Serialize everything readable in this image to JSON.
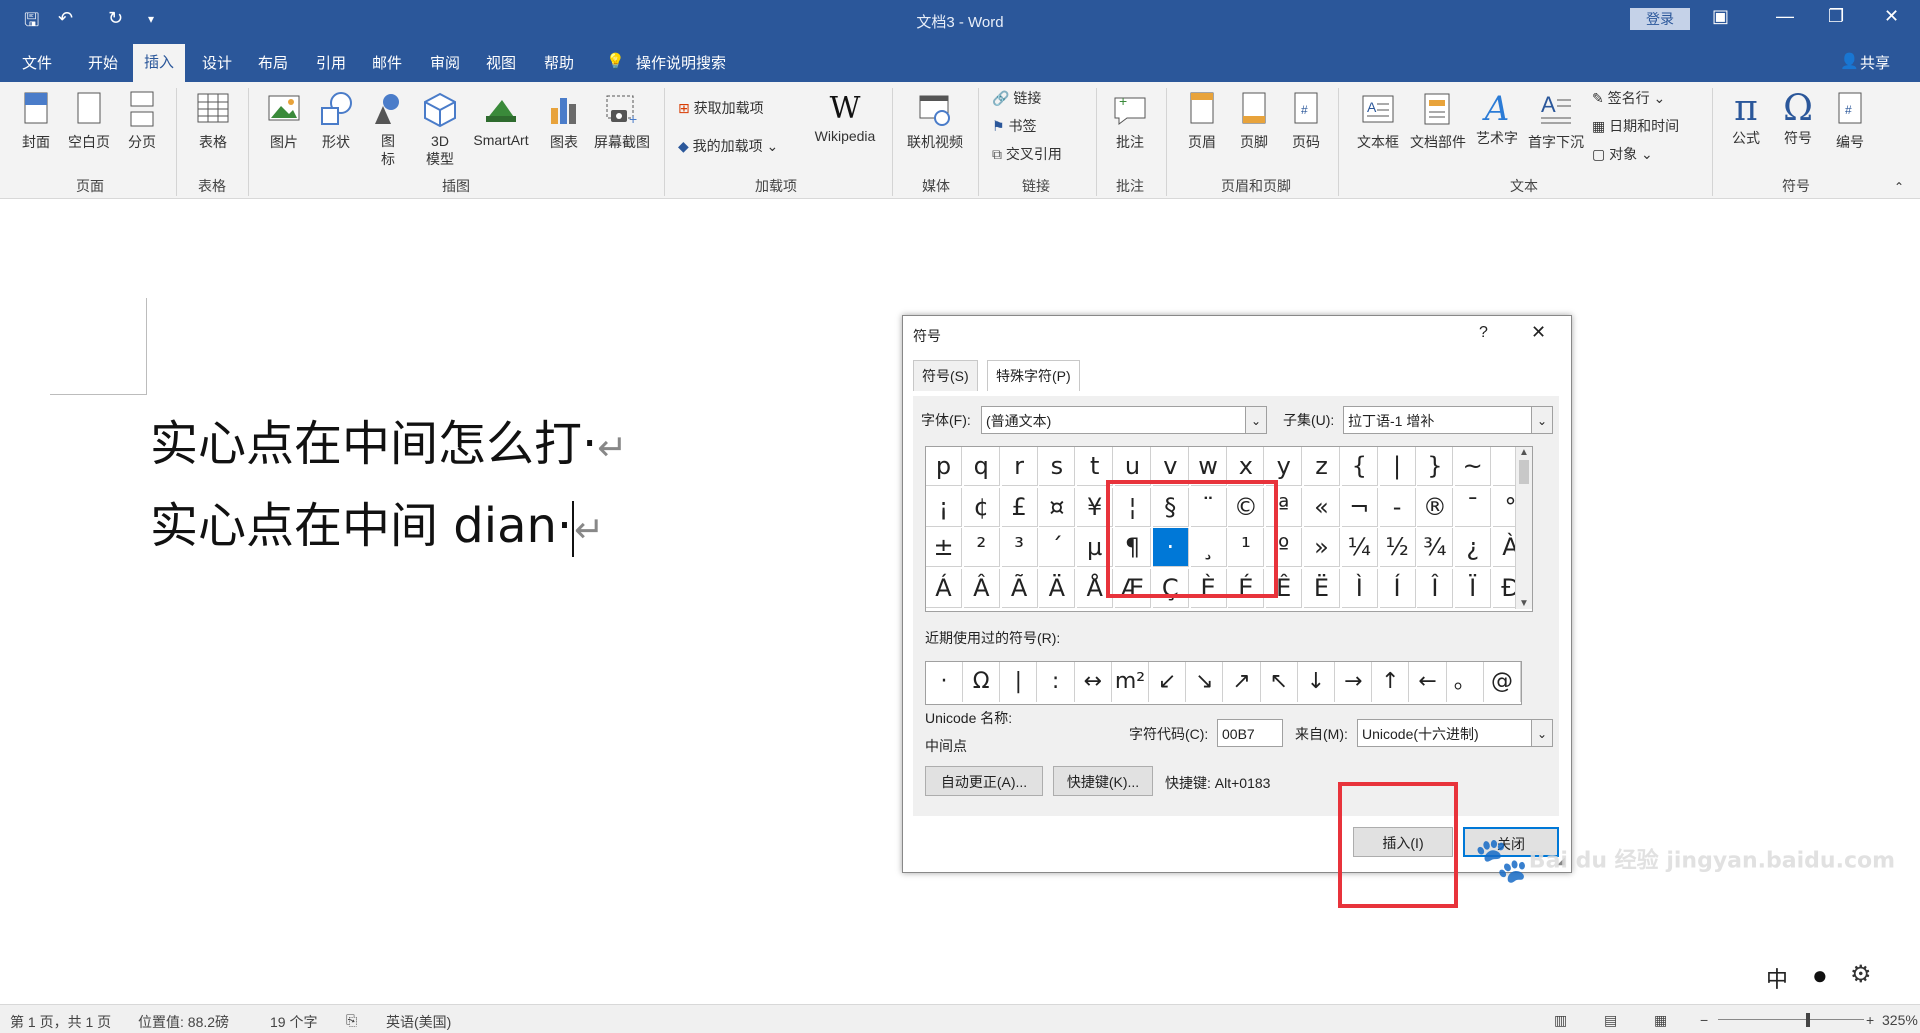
{
  "titlebar": {
    "doc_title": "文档3 - Word",
    "login": "登录",
    "quick_access": [
      "save-icon",
      "undo-icon",
      "redo-icon",
      "customize-icon"
    ]
  },
  "menu": {
    "tabs": [
      "文件",
      "开始",
      "插入",
      "设计",
      "布局",
      "引用",
      "邮件",
      "审阅",
      "视图",
      "帮助"
    ],
    "active_tab": "插入",
    "tell_me": "操作说明搜索",
    "share": "共享"
  },
  "ribbon": {
    "pages": [
      "封面",
      "空白页",
      "分页"
    ],
    "table": "表格",
    "illustrations": [
      "图片",
      "形状",
      "图标",
      "3D模型",
      "SmartArt",
      "图表",
      "屏幕截图"
    ],
    "icons_label": "图\n标",
    "model_label": "3D\n模型",
    "addins": {
      "get": "获取加载项",
      "my": "我的加载项",
      "wiki": "Wikipedia"
    },
    "media": "联机视频",
    "links": [
      "链接",
      "书签",
      "交叉引用"
    ],
    "comment": "批注",
    "header_footer": [
      "页眉",
      "页脚",
      "页码"
    ],
    "text": [
      "文本框",
      "文档部件",
      "艺术字",
      "首字下沉"
    ],
    "text_small": [
      "签名行",
      "日期和时间",
      "对象"
    ],
    "symbols": [
      "公式",
      "符号",
      "编号"
    ],
    "groups": [
      "页面",
      "表格",
      "插图",
      "加载项",
      "媒体",
      "链接",
      "批注",
      "页眉和页脚",
      "文本",
      "符号"
    ]
  },
  "document": {
    "line1": "实心点在中间怎么打·",
    "line2": "实心点在中间 dian·"
  },
  "dialog": {
    "title": "符号",
    "help": "?",
    "close": "✕",
    "tabs": [
      "符号(S)",
      "特殊字符(P)"
    ],
    "font_label": "字体(F):",
    "font_value": "(普通文本)",
    "subset_label": "子集(U):",
    "subset_value": "拉丁语-1 增补",
    "grid_rows": [
      [
        "p",
        "q",
        "r",
        "s",
        "t",
        "u",
        "v",
        "w",
        "x",
        "y",
        "z",
        "{",
        "|",
        "}",
        "~",
        ""
      ],
      [
        "¡",
        "¢",
        "£",
        "¤",
        "¥",
        "¦",
        "§",
        "¨",
        "©",
        "ª",
        "«",
        "¬",
        "-",
        "®",
        "¯",
        "°"
      ],
      [
        "±",
        "²",
        "³",
        "´",
        "µ",
        "¶",
        "·",
        "¸",
        "¹",
        "º",
        "»",
        "¼",
        "½",
        "¾",
        "¿",
        "À"
      ],
      [
        "Á",
        "Â",
        "Ã",
        "Ä",
        "Å",
        "Æ",
        "Ç",
        "È",
        "É",
        "Ê",
        "Ë",
        "Ì",
        "Í",
        "Î",
        "Ï",
        "Ð"
      ]
    ],
    "selected_symbol": "·",
    "recent_label": "近期使用过的符号(R):",
    "recent": [
      "·",
      "Ω",
      "|",
      ":",
      "↔",
      "m²",
      "↙",
      "↘",
      "↗",
      "↖",
      "↓",
      "→",
      "↑",
      "←",
      "。",
      "@"
    ],
    "unicode_name_label": "Unicode 名称:",
    "unicode_name": "中间点",
    "char_code_label": "字符代码(C):",
    "char_code": "00B7",
    "from_label": "来自(M):",
    "from_value": "Unicode(十六进制)",
    "autocorrect": "自动更正(A)...",
    "shortcut_btn": "快捷键(K)...",
    "shortcut_text": "快捷键: Alt+0183",
    "insert": "插入(I)",
    "close_btn": "关闭"
  },
  "status": {
    "page": "第 1 页，共 1 页",
    "position": "位置值: 88.2磅",
    "words": "19 个字",
    "language": "英语(美国)",
    "zoom": "325%"
  },
  "watermark": "Bai du 经验 jingyan.baidu.com",
  "ime": "中"
}
